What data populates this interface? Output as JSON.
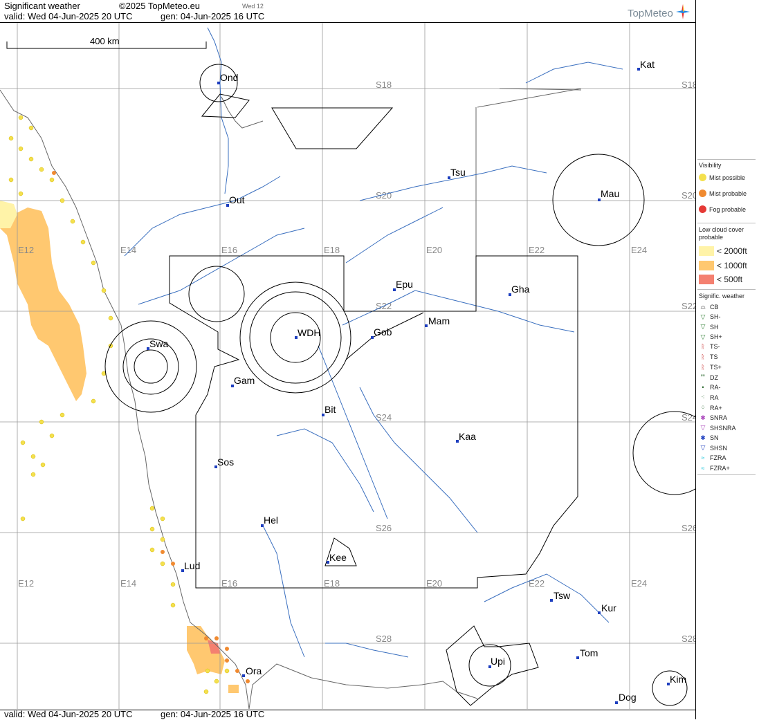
{
  "header": {
    "title": "Significant weather",
    "copyright": "©2025 TopMeteo.eu",
    "day": "Wed 12",
    "valid": "valid:  Wed  04-Jun-2025  20 UTC",
    "generated": "gen: 04-Jun-2025 16 UTC",
    "logo": "TopMeteo"
  },
  "scale": {
    "label": "400 km"
  },
  "grid": {
    "lon_labels": [
      "E12",
      "E14",
      "E16",
      "E18",
      "E20",
      "E22",
      "E24"
    ],
    "lat_labels": [
      "S18",
      "S20",
      "S22",
      "S24",
      "S26",
      "S28"
    ]
  },
  "cities": [
    {
      "code": "Ond"
    },
    {
      "code": "Kat"
    },
    {
      "code": "Tsu"
    },
    {
      "code": "Out"
    },
    {
      "code": "Mau"
    },
    {
      "code": "Epu"
    },
    {
      "code": "Gha"
    },
    {
      "code": "Mam"
    },
    {
      "code": "Gob"
    },
    {
      "code": "WDH"
    },
    {
      "code": "Swa"
    },
    {
      "code": "Gam"
    },
    {
      "code": "Bit"
    },
    {
      "code": "Kaa"
    },
    {
      "code": "Sos"
    },
    {
      "code": "Hel"
    },
    {
      "code": "Kee"
    },
    {
      "code": "Lud"
    },
    {
      "code": "Tsw"
    },
    {
      "code": "Kur"
    },
    {
      "code": "Tom"
    },
    {
      "code": "Upi"
    },
    {
      "code": "Ora"
    },
    {
      "code": "Kim"
    },
    {
      "code": "Dog"
    }
  ],
  "footer": {
    "valid": "valid:  Wed  04-Jun-2025  20 UTC",
    "generated": "gen: 04-Jun-2025 16 UTC"
  },
  "legend": {
    "visibility_title": "Visibility",
    "visibility": [
      {
        "label": "Mist possible",
        "color": "#f4e04d"
      },
      {
        "label": "Mist probable",
        "color": "#f08a30"
      },
      {
        "label": "Fog probable",
        "color": "#e53935"
      }
    ],
    "cloud_title_1": "Low cloud cover",
    "cloud_title_2": "probable",
    "cloud": [
      {
        "label": "< 2000ft",
        "color": "#fff3a8"
      },
      {
        "label": "< 1000ft",
        "color": "#ffc870"
      },
      {
        "label": "<   500ft",
        "color": "#f48070"
      }
    ],
    "weather_title": "Signific. weather",
    "weather": [
      {
        "label": "CB",
        "color": "#000000"
      },
      {
        "label": "SH-",
        "color": "#2e7d32"
      },
      {
        "label": "SH",
        "color": "#2e7d32"
      },
      {
        "label": "SH+",
        "color": "#2e7d32"
      },
      {
        "label": "TS-",
        "color": "#c62828"
      },
      {
        "label": "TS",
        "color": "#c62828"
      },
      {
        "label": "TS+",
        "color": "#c62828"
      },
      {
        "label": "DZ",
        "color": "#1b5e20"
      },
      {
        "label": "RA-",
        "color": "#1b5e20"
      },
      {
        "label": "RA",
        "color": "#1b5e20"
      },
      {
        "label": "RA+",
        "color": "#1b5e20"
      },
      {
        "label": "SNRA",
        "color": "#ab47bc"
      },
      {
        "label": "SHSNRA",
        "color": "#ab47bc"
      },
      {
        "label": "SN",
        "color": "#1e3fbf"
      },
      {
        "label": "SHSN",
        "color": "#1e3fbf"
      },
      {
        "label": "FZRA",
        "color": "#26c6da"
      },
      {
        "label": "FZRA+",
        "color": "#26c6da"
      }
    ]
  }
}
